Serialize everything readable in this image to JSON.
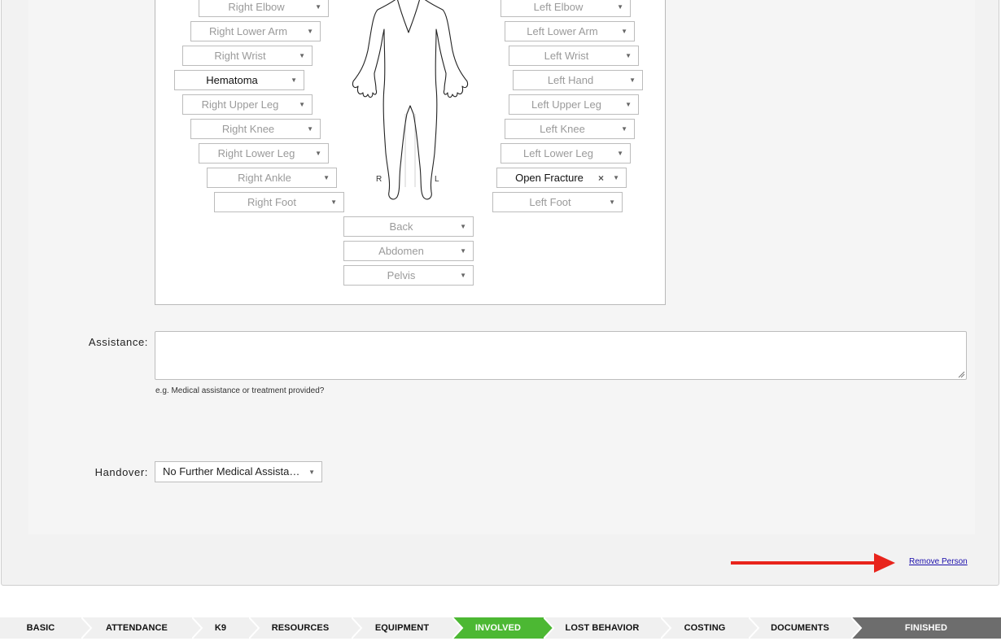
{
  "body_map": {
    "right_selects": [
      {
        "label": "Right Elbow",
        "filled": false
      },
      {
        "label": "Right Lower Arm",
        "filled": false
      },
      {
        "label": "Right Wrist",
        "filled": false
      },
      {
        "label": "Hematoma",
        "filled": true
      },
      {
        "label": "Right Upper Leg",
        "filled": false
      },
      {
        "label": "Right Knee",
        "filled": false
      },
      {
        "label": "Right Lower Leg",
        "filled": false
      },
      {
        "label": "Right Ankle",
        "filled": false
      },
      {
        "label": "Right Foot",
        "filled": false
      }
    ],
    "left_selects": [
      {
        "label": "Left Elbow",
        "filled": false
      },
      {
        "label": "Left Lower Arm",
        "filled": false
      },
      {
        "label": "Left Wrist",
        "filled": false
      },
      {
        "label": "Left Hand",
        "filled": false
      },
      {
        "label": "Left Upper Leg",
        "filled": false
      },
      {
        "label": "Left Knee",
        "filled": false
      },
      {
        "label": "Left Lower Leg",
        "filled": false
      },
      {
        "label": "Open Fracture",
        "filled": true
      },
      {
        "label": "Left Foot",
        "filled": false
      }
    ],
    "center_selects": [
      {
        "label": "Back"
      },
      {
        "label": "Abdomen"
      },
      {
        "label": "Pelvis"
      }
    ],
    "figure_right_label": "R",
    "figure_left_label": "L",
    "arrow_icon": "chevron-down-icon",
    "clear_icon": "close-icon"
  },
  "assistance": {
    "label": "Assistance:",
    "value": "",
    "hint": "e.g. Medical assistance or treatment provided?"
  },
  "handover": {
    "label": "Handover:",
    "value": "No Further Medical Assista…"
  },
  "remove_person": "Remove Person",
  "colors": {
    "active_step": "#4cb833",
    "finish_step": "#6d6d6d",
    "annotation_arrow": "#e8241c",
    "link": "#1a0dab"
  },
  "steps": [
    {
      "label": "BASIC",
      "state": "normal"
    },
    {
      "label": "ATTENDANCE",
      "state": "normal"
    },
    {
      "label": "K9",
      "state": "normal"
    },
    {
      "label": "RESOURCES",
      "state": "normal"
    },
    {
      "label": "EQUIPMENT",
      "state": "normal"
    },
    {
      "label": "INVOLVED",
      "state": "active"
    },
    {
      "label": "LOST BEHAVIOR",
      "state": "normal"
    },
    {
      "label": "COSTING",
      "state": "normal"
    },
    {
      "label": "DOCUMENTS",
      "state": "normal"
    },
    {
      "label": "FINISHED",
      "state": "finish"
    }
  ]
}
